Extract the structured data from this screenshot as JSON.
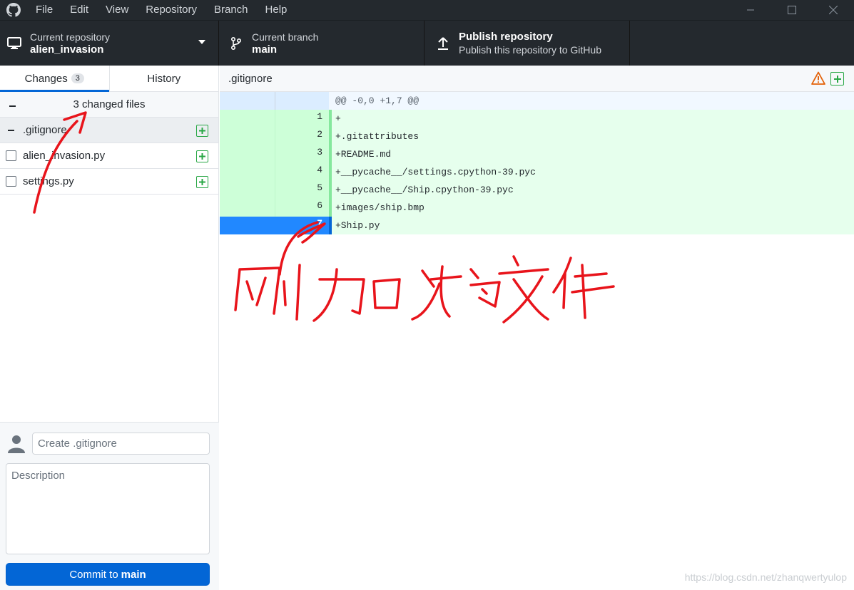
{
  "menu": {
    "items": [
      "File",
      "Edit",
      "View",
      "Repository",
      "Branch",
      "Help"
    ]
  },
  "toolbar": {
    "repo_label": "Current repository",
    "repo_value": "alien_invasion",
    "branch_label": "Current branch",
    "branch_value": "main",
    "publish_title": "Publish repository",
    "publish_subtitle": "Publish this repository to GitHub"
  },
  "tabs": {
    "changes_label": "Changes",
    "changes_count": "3",
    "history_label": "History"
  },
  "changes": {
    "summary": "3 changed files",
    "files": [
      {
        "name": ".gitignore",
        "state": "selected"
      },
      {
        "name": "alien_invasion.py",
        "state": "unchecked"
      },
      {
        "name": "settings.py",
        "state": "unchecked"
      }
    ]
  },
  "commit": {
    "summary_placeholder": "Create .gitignore",
    "description_placeholder": "Description",
    "button_prefix": "Commit to",
    "button_branch": "main"
  },
  "diff": {
    "file_title": ".gitignore",
    "hunk_header": "@@ -0,0 +1,7 @@",
    "lines": [
      {
        "num": "1",
        "text": "+"
      },
      {
        "num": "2",
        "text": "+.gitattributes"
      },
      {
        "num": "3",
        "text": "+README.md"
      },
      {
        "num": "4",
        "text": "+__pycache__/settings.cpython-39.pyc"
      },
      {
        "num": "5",
        "text": "+__pycache__/Ship.cpython-39.pyc"
      },
      {
        "num": "6",
        "text": "+images/ship.bmp"
      },
      {
        "num": "7",
        "text": "+Ship.py"
      }
    ],
    "selected_line": "7"
  },
  "annotation": {
    "handwritten_text": "刚加入的文件",
    "color": "#e8141b"
  },
  "watermark": "https://blog.csdn.net/zhanqwertyulop",
  "colors": {
    "titlebar": "#24292e",
    "accent": "#0366d6",
    "added_green": "#28a745",
    "warning_orange": "#e36209"
  }
}
